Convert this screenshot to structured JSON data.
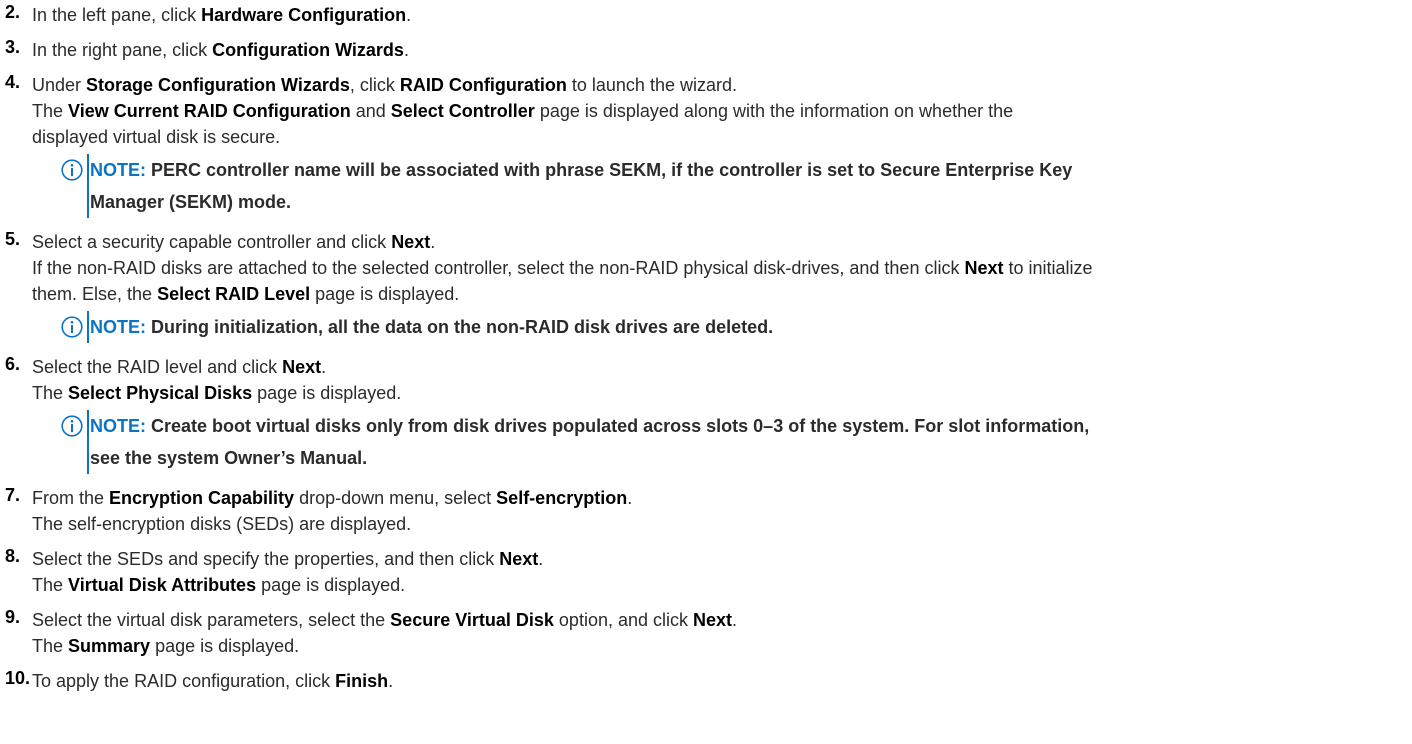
{
  "steps": [
    {
      "num": "2.",
      "lines": [
        [
          "In the left pane, click ",
          "*Hardware Configuration",
          "."
        ]
      ]
    },
    {
      "num": "3.",
      "lines": [
        [
          "In the right pane, click ",
          "*Configuration Wizards",
          "."
        ]
      ]
    },
    {
      "num": "4.",
      "lines": [
        [
          "Under ",
          "*Storage Configuration Wizards",
          ", click ",
          "*RAID Configuration",
          " to launch the wizard."
        ],
        [
          "The ",
          "*View Current RAID Configuration",
          " and ",
          "*Select Controller",
          " page is displayed along with the information on whether the"
        ],
        [
          "displayed virtual disk is secure."
        ]
      ],
      "note": {
        "label": "NOTE:",
        "lines": [
          " PERC controller name will be associated with phrase SEKM, if the controller is set to Secure Enterprise Key",
          "Manager (SEKM) mode."
        ]
      }
    },
    {
      "num": "5.",
      "lines": [
        [
          "Select a security capable controller and click ",
          "*Next",
          "."
        ],
        [
          "If the non-RAID disks are attached to the selected controller, select the non-RAID physical disk-drives, and then click ",
          "*Next",
          " to initialize"
        ],
        [
          "them. Else, the ",
          "*Select RAID Level",
          " page is displayed."
        ]
      ],
      "note": {
        "label": "NOTE:",
        "lines": [
          " During initialization, all the data on the non-RAID disk drives are deleted."
        ]
      }
    },
    {
      "num": "6.",
      "lines": [
        [
          "Select the RAID level and click ",
          "*Next",
          "."
        ],
        [
          "The ",
          "*Select Physical Disks",
          " page is displayed."
        ]
      ],
      "note": {
        "label": "NOTE:",
        "lines": [
          " Create boot virtual disks only from disk drives populated across slots 0–3 of the system. For slot information,",
          "see the system Owner’s Manual."
        ]
      }
    },
    {
      "num": "7.",
      "lines": [
        [
          "From the ",
          "*Encryption Capability",
          " drop-down menu, select ",
          "*Self-encryption",
          "."
        ],
        [
          "The self-encryption disks (SEDs) are displayed."
        ]
      ]
    },
    {
      "num": "8.",
      "lines": [
        [
          "Select the SEDs and specify the properties, and then click ",
          "*Next",
          "."
        ],
        [
          "The ",
          "*Virtual Disk Attributes",
          " page is displayed."
        ]
      ]
    },
    {
      "num": "9.",
      "lines": [
        [
          "Select the virtual disk parameters, select the ",
          "*Secure Virtual Disk",
          " option, and click ",
          "*Next",
          "."
        ],
        [
          "The ",
          "*Summary",
          " page is displayed."
        ]
      ]
    },
    {
      "num": "10.",
      "lines": [
        [
          "To apply the RAID configuration, click ",
          "*Finish",
          "."
        ]
      ]
    }
  ],
  "colors": {
    "accent": "#0b74c4",
    "text": "#2b2b2b"
  },
  "icons": {
    "note": "info-circle-icon"
  }
}
